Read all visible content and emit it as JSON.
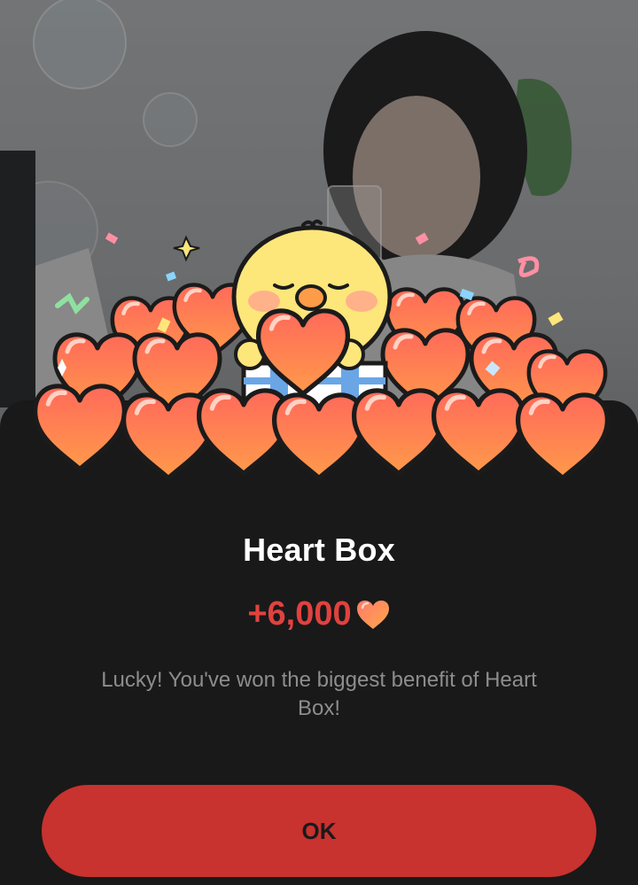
{
  "dialog": {
    "title": "Heart Box",
    "amount": "+6,000",
    "amount_icon": "heart-icon",
    "message": "Lucky! You've won the biggest benefit of Heart Box!",
    "ok_label": "OK"
  },
  "colors": {
    "sheet_background": "#191919",
    "amount": "#e0423f",
    "ok_button": "#c8322f",
    "message": "#8d8d8d"
  }
}
